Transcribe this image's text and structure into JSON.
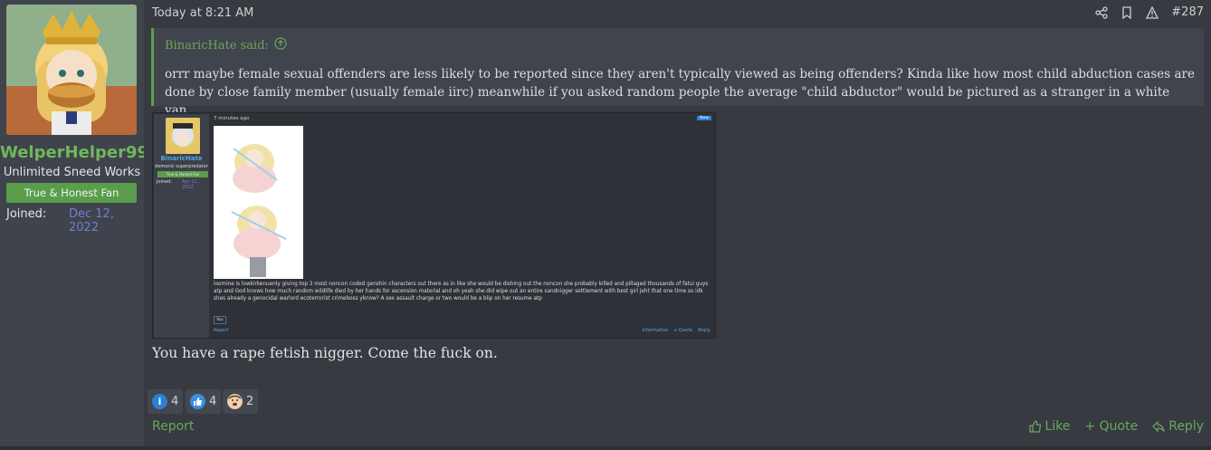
{
  "user": {
    "name": "WelperHelper99",
    "title": "Unlimited Sneed Works",
    "banner": "True & Honest Fan",
    "joined_label": "Joined:",
    "joined_date": "Dec 12, 2022"
  },
  "post": {
    "timestamp": "Today at 8:21 AM",
    "post_number": "#287",
    "quote": {
      "author": "BinaricHate said:",
      "text": "orrr maybe female sexual offenders are less likely to be reported since they aren't typically viewed as being offenders? Kinda like how most child abduction cases are done by close family member (usually female iirc) meanwhile if you asked random people the average \"child abductor\" would be pictured as a stranger in a white van."
    },
    "embedded_screenshot": {
      "username": "BinaricHate",
      "user_title": "demonic superpredator",
      "banner": "True & Honest Fan",
      "joined_label": "Joined:",
      "joined_date": "Apr 11, 2022",
      "time": "7 minutes ago",
      "new_badge": "New",
      "text": "loomine is lowkirkenuenly giving top 3 most noncon coded genshin characters out there as in like she would be dishing out the noncon she probably killed and pillaged thousands of fatui guys atp and God knows how much random wildlife died by her hands for ascension material and oh yeah she did wipe out an entire sandnigger settlement with best girl jeht that one time so idk shes already a genocidal warlord ecoterrorist crimeboss yknow? A sex assault charge or two would be a blip on her resume atp",
      "reaction": "You",
      "report": "Report",
      "action_informative": "Informative",
      "action_quote": "+ Quote",
      "action_reply": "Reply"
    },
    "message": "You have a rape fetish nigger. Come the fuck on."
  },
  "reactions": [
    {
      "icon": "informative-icon",
      "count": "4",
      "color": "#2d7fd3"
    },
    {
      "icon": "like-icon",
      "count": "4",
      "color": "#3b8de0"
    },
    {
      "icon": "face-icon",
      "count": "2",
      "color": "#e9c9a7"
    }
  ],
  "footer": {
    "report": "Report",
    "like": "Like",
    "quote": "+ Quote",
    "reply": "Reply"
  },
  "colors": {
    "accent_green": "#6aa85a",
    "username_green": "#71b75c",
    "joined_blue": "#6c7fd8",
    "background": "#373a41"
  }
}
